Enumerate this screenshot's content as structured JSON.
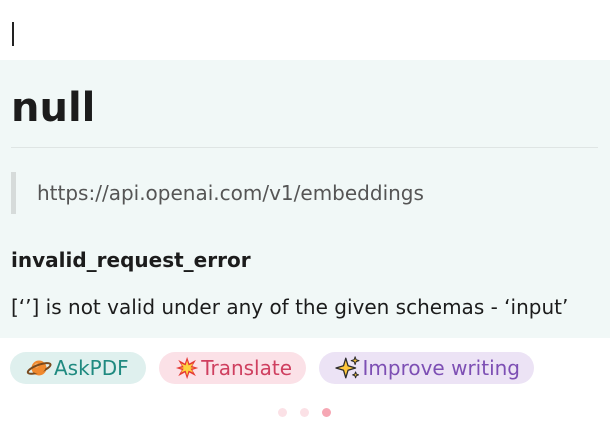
{
  "result": {
    "title": "null",
    "url": "https://api.openai.com/v1/embeddings",
    "error_type": "invalid_request_error",
    "error_message": "[‘’] is not valid under any of the given schemas - ‘input’"
  },
  "actions": [
    {
      "label": "AskPDF",
      "icon": "planet-icon",
      "color": "#1f8a80"
    },
    {
      "label": "Translate",
      "icon": "starburst-icon",
      "color": "#cf3f5f"
    },
    {
      "label": "Improve writing",
      "icon": "sparkles-icon",
      "color": "#7d4fb4"
    }
  ],
  "pagination": {
    "count": 3,
    "active_index": 2,
    "active_color": "#f6a7b4",
    "inactive_color": "#fbe1e6"
  },
  "colors": {
    "result_bg": "#f1f8f7",
    "accent_teal": "#1f8a80"
  }
}
